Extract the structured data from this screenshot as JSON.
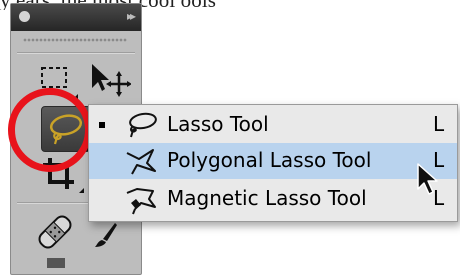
{
  "caption": {
    "text": "y            ears, the most cool             ools"
  },
  "menu": {
    "items": [
      {
        "label": "Lasso Tool",
        "shortcut": "L",
        "icon": "lasso-icon",
        "active": true,
        "highlighted": false
      },
      {
        "label": "Polygonal Lasso Tool",
        "shortcut": "L",
        "icon": "polygonal-lasso-icon",
        "active": false,
        "highlighted": true
      },
      {
        "label": "Magnetic Lasso Tool",
        "shortcut": "L",
        "icon": "magnetic-lasso-icon",
        "active": false,
        "highlighted": false
      }
    ]
  },
  "colors": {
    "highlight": "#b9d3ee",
    "annotation_circle": "#e8131b",
    "lasso_icon": "#c9a227"
  }
}
